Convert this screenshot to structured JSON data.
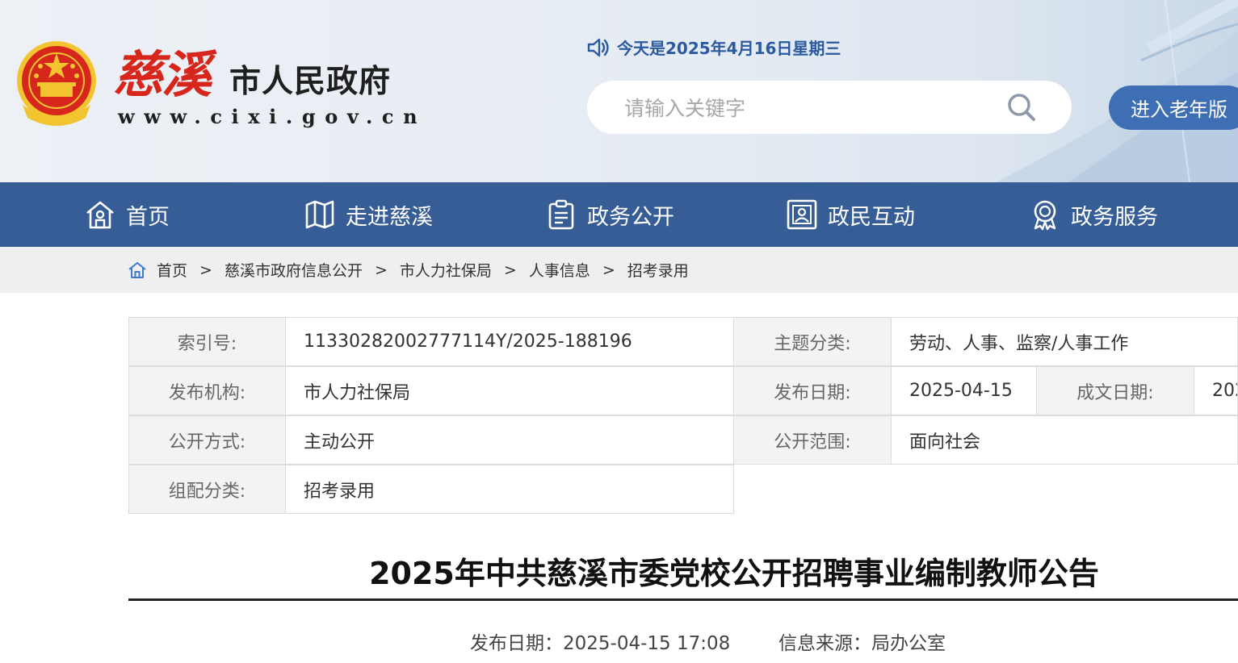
{
  "header": {
    "logo_calligraphy": "慈溪",
    "logo_name": "市人民政府",
    "logo_url": "www.cixi.gov.cn",
    "date_text": "今天是2025年4月16日星期三",
    "search_placeholder": "请输入关键字",
    "elder_button": "进入老年版",
    "icons": [
      "national-emblem",
      "speaker-icon",
      "search-icon"
    ]
  },
  "nav": {
    "items": [
      {
        "label": "首页",
        "icon": "home-icon"
      },
      {
        "label": "走进慈溪",
        "icon": "map-icon"
      },
      {
        "label": "政务公开",
        "icon": "clipboard-icon"
      },
      {
        "label": "政民互动",
        "icon": "user-card-icon"
      },
      {
        "label": "政务服务",
        "icon": "badge-icon"
      }
    ]
  },
  "breadcrumb": {
    "items": [
      "首页",
      "慈溪市政府信息公开",
      "市人力社保局",
      "人事信息",
      "招考录用"
    ],
    "separator": ">"
  },
  "info": {
    "index_label": "索引号:",
    "index_value": "11330282002777114Y/2025-188196",
    "topic_label": "主题分类:",
    "topic_value": "劳动、人事、监察/人事工作",
    "org_label": "发布机构:",
    "org_value": "市人力社保局",
    "pub_label": "发布日期:",
    "pub_value": "2025-04-15",
    "made_label": "成文日期:",
    "made_value": "202",
    "mode_label": "公开方式:",
    "mode_value": "主动公开",
    "scope_label": "公开范围:",
    "scope_value": "面向社会",
    "category_label": "组配分类:",
    "category_value": "招考录用"
  },
  "article": {
    "title": "2025年中共慈溪市委党校公开招聘事业编制教师公告",
    "publish": "发布日期：2025-04-15 17:08",
    "source": "信息来源：局办公室"
  },
  "colors": {
    "nav_bg": "#365d95",
    "accent_blue": "#2b5aa0",
    "elder_btn": "#3e6fb4",
    "logo_red": "#d7261c"
  }
}
